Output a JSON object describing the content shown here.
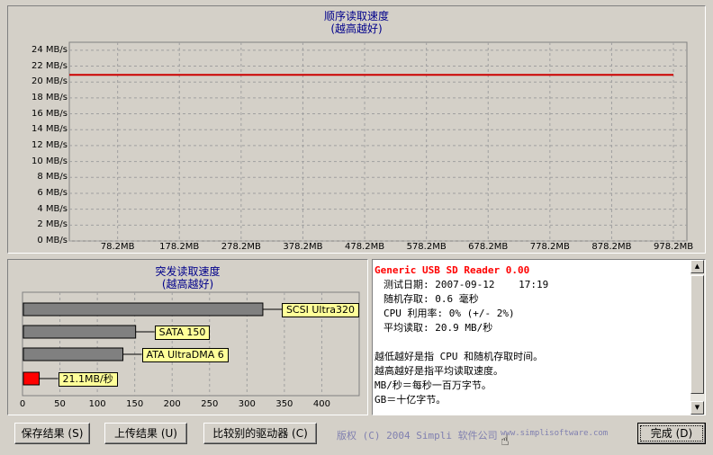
{
  "seq_chart": {
    "title": "顺序读取速度",
    "subtitle": "(越高越好)",
    "y_ticks": [
      "24 MB/s",
      "22 MB/s",
      "20 MB/s",
      "18 MB/s",
      "16 MB/s",
      "14 MB/s",
      "12 MB/s",
      "10 MB/s",
      "8 MB/s",
      "6 MB/s",
      "4 MB/s",
      "2 MB/s",
      "0 MB/s"
    ],
    "x_ticks": [
      "78.2MB",
      "178.2MB",
      "278.2MB",
      "378.2MB",
      "478.2MB",
      "578.2MB",
      "678.2MB",
      "778.2MB",
      "878.2MB",
      "978.2MB"
    ],
    "line_color": "#cc0000"
  },
  "burst_chart": {
    "title": "突发读取速度",
    "subtitle": "(越高越好)",
    "x_ticks": [
      "0",
      "50",
      "100",
      "150",
      "200",
      "250",
      "300",
      "350",
      "400"
    ]
  },
  "chart_data": [
    {
      "type": "line",
      "title": "顺序读取速度",
      "subtitle": "(越高越好)",
      "xlabel": "",
      "ylabel": "",
      "x_categories": [
        "78.2MB",
        "178.2MB",
        "278.2MB",
        "378.2MB",
        "478.2MB",
        "578.2MB",
        "678.2MB",
        "778.2MB",
        "878.2MB",
        "978.2MB"
      ],
      "x": [
        0,
        978.2
      ],
      "values": [
        20.9,
        20.9
      ],
      "ylim": [
        0,
        25
      ],
      "grid": true
    },
    {
      "type": "bar",
      "orientation": "horizontal",
      "title": "突发读取速度",
      "subtitle": "(越高越好)",
      "categories": [
        "SCSI Ultra320",
        "SATA 150",
        "ATA UltraDMA 6",
        "21.1MB/秒"
      ],
      "values": [
        320,
        150,
        133,
        21.1
      ],
      "colors": [
        "#808080",
        "#808080",
        "#808080",
        "#ff0000"
      ],
      "xlim": [
        0,
        450
      ],
      "grid": true
    }
  ],
  "info": {
    "device": "Generic USB SD Reader 0.00",
    "date_label": "测试日期:",
    "date_value": "2007-09-12",
    "time_value": "17:19",
    "random_label": "随机存取:",
    "random_value": "0.6 毫秒",
    "cpu_label": "CPU 利用率:",
    "cpu_value": "0% (+/- 2%)",
    "avg_label": "平均读取:",
    "avg_value": "20.9 MB/秒",
    "note1": "越低越好是指 CPU 和随机存取时间。",
    "note2": "越高越好是指平均读取速度。",
    "note3": "MB/秒＝每秒一百万字节。",
    "note4": "GB＝十亿字节。"
  },
  "footer": {
    "save_label": "保存结果 (S)",
    "upload_label": "上传结果 (U)",
    "compare_label": "比较别的驱动器 (C)",
    "copyright": "版权 (C) 2004 Simpli 软件公司",
    "website": "www.simplisoftware.com",
    "done_label": "完成 (D)"
  },
  "colors": {
    "accent": "#00008b",
    "series": "#cc0000",
    "device": "#ff0000",
    "label_bg": "#ffff99"
  }
}
